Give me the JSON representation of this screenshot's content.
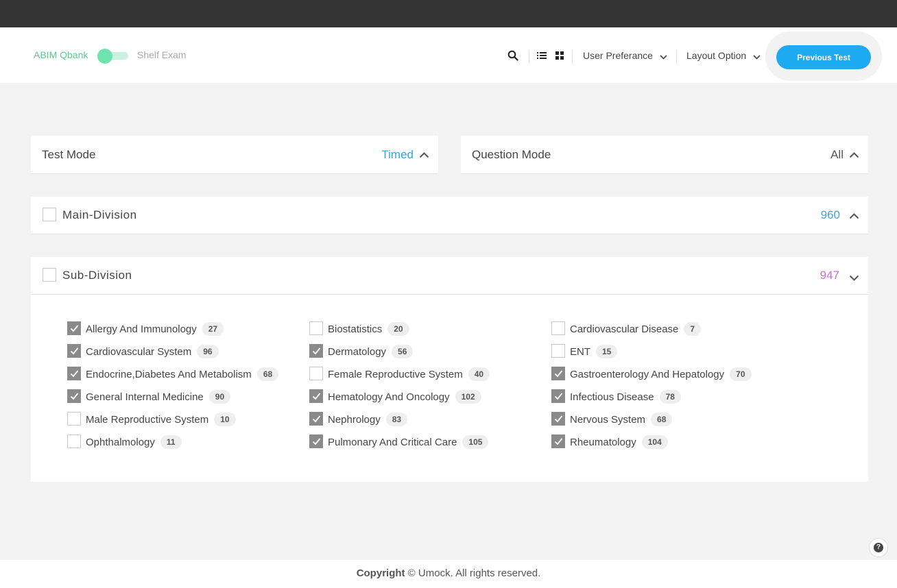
{
  "header": {
    "brand_left": "ABIM Qbank",
    "brand_right": "Shelf Exam",
    "user_preference": "User Preferance",
    "layout_option": "Layout Option",
    "previous_test": "Previous Test"
  },
  "test_mode": {
    "title": "Test Mode",
    "value": "Timed"
  },
  "question_mode": {
    "title": "Question Mode",
    "value": "All"
  },
  "main_division": {
    "title": "Main-Division",
    "count": "960"
  },
  "sub_division": {
    "title": "Sub-Division",
    "count": "947",
    "items": [
      {
        "label": "Allergy And Immunology",
        "count": "27",
        "checked": true
      },
      {
        "label": "Biostatistics",
        "count": "20",
        "checked": false
      },
      {
        "label": "Cardiovascular Disease",
        "count": "7",
        "checked": false
      },
      {
        "label": "Cardiovascular System",
        "count": "96",
        "checked": true
      },
      {
        "label": "Dermatology",
        "count": "56",
        "checked": true
      },
      {
        "label": "ENT",
        "count": "15",
        "checked": false
      },
      {
        "label": "Endocrine,Diabetes And Metabolism",
        "count": "68",
        "checked": true
      },
      {
        "label": "Female Reproductive System",
        "count": "40",
        "checked": false
      },
      {
        "label": "Gastroenterology And Hepatology",
        "count": "70",
        "checked": true
      },
      {
        "label": "General Internal Medicine",
        "count": "90",
        "checked": true
      },
      {
        "label": "Hematology And Oncology",
        "count": "102",
        "checked": true
      },
      {
        "label": "Infectious Disease",
        "count": "78",
        "checked": true
      },
      {
        "label": "Male Reproductive System",
        "count": "10",
        "checked": false
      },
      {
        "label": "Nephrology",
        "count": "83",
        "checked": true
      },
      {
        "label": "Nervous System",
        "count": "68",
        "checked": true
      },
      {
        "label": "Ophthalmology",
        "count": "11",
        "checked": false
      },
      {
        "label": "Pulmonary And Critical Care",
        "count": "105",
        "checked": true
      },
      {
        "label": "Rheumatology",
        "count": "104",
        "checked": true
      }
    ]
  },
  "footer": {
    "copyright": "Copyright",
    "rest": " © Umock. All rights reserved."
  },
  "help": {
    "label": "?"
  },
  "colors": {
    "accent_blue": "#1eaaf1",
    "accent_green": "#5cc98f",
    "main_count": "#4a9fd8",
    "sub_count": "#c86fd6",
    "timed": "#2fa7e3"
  },
  "icons": [
    "search-icon",
    "list-view-icon",
    "grid-view-icon",
    "chevron-down-icon",
    "chevron-up-icon",
    "check-icon",
    "help-icon"
  ]
}
